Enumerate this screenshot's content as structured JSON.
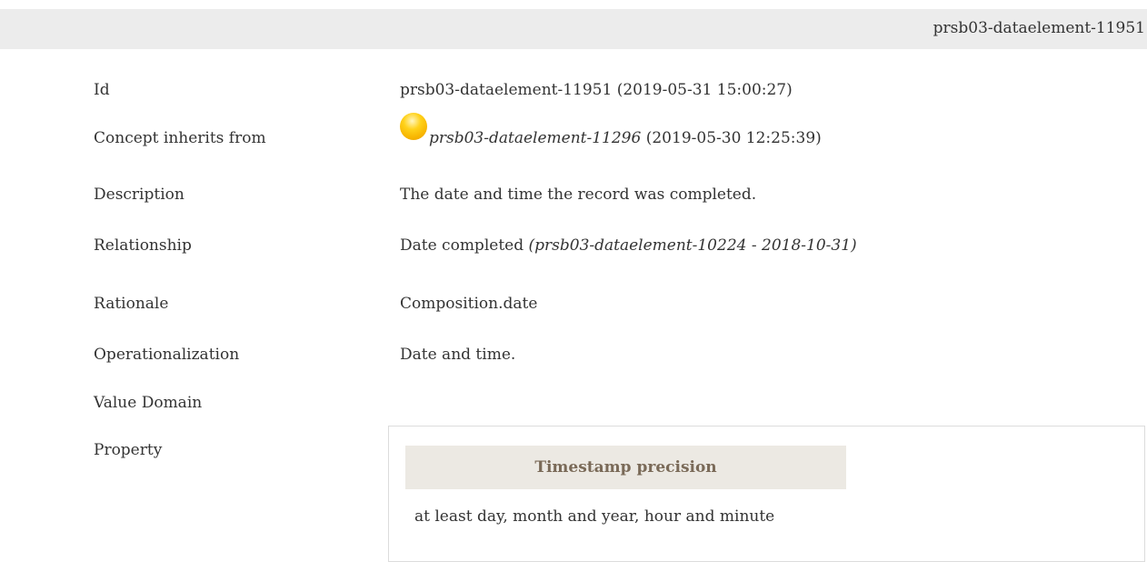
{
  "header": {
    "id": "prsb03-dataelement-11951"
  },
  "fields": {
    "id": {
      "label": "Id",
      "value": "prsb03-dataelement-11951 (2019-05-31 15:00:27)"
    },
    "inherits": {
      "label": "Concept inherits from",
      "link": "prsb03-dataelement-11296",
      "date": "(2019-05-30 12:25:39)",
      "status_icon": "yellow-circle-icon",
      "status_color": "#f7b400"
    },
    "description": {
      "label": "Description",
      "value": "The date and time the record was completed."
    },
    "relationship": {
      "label": "Relationship",
      "value": "Date completed",
      "ref": "(prsb03-dataelement-10224 - 2018-10-31)"
    },
    "rationale": {
      "label": "Rationale",
      "value": "Composition.date"
    },
    "operationalization": {
      "label": "Operationalization",
      "value": "Date and time."
    },
    "value_domain": {
      "label": "Value Domain"
    },
    "property": {
      "label": "Property",
      "header": "Timestamp precision",
      "value": "at least day, month and year, hour and minute"
    }
  },
  "colors": {
    "header_bar": "#ececec",
    "property_header_bg": "#ece9e3",
    "property_header_text": "#7a6a58"
  }
}
